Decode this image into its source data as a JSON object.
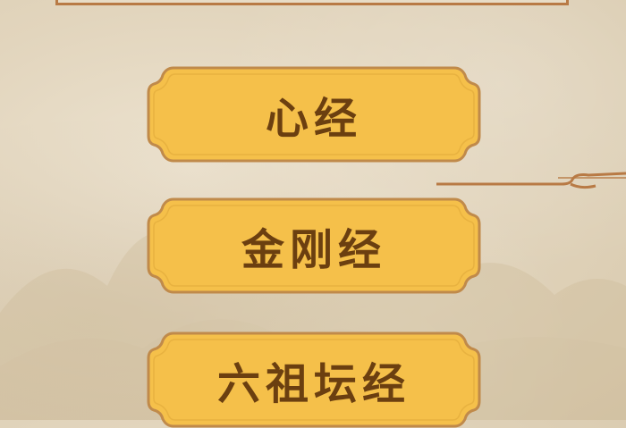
{
  "menu": {
    "items": [
      {
        "label": "心经"
      },
      {
        "label": "金刚经"
      },
      {
        "label": "六祖坛经"
      }
    ]
  },
  "colors": {
    "button_fill": "#f5c04a",
    "button_border": "#c08a4a",
    "label": "#6b3f10",
    "frame_accent": "#b87a45",
    "background": "#e2d5bd"
  }
}
